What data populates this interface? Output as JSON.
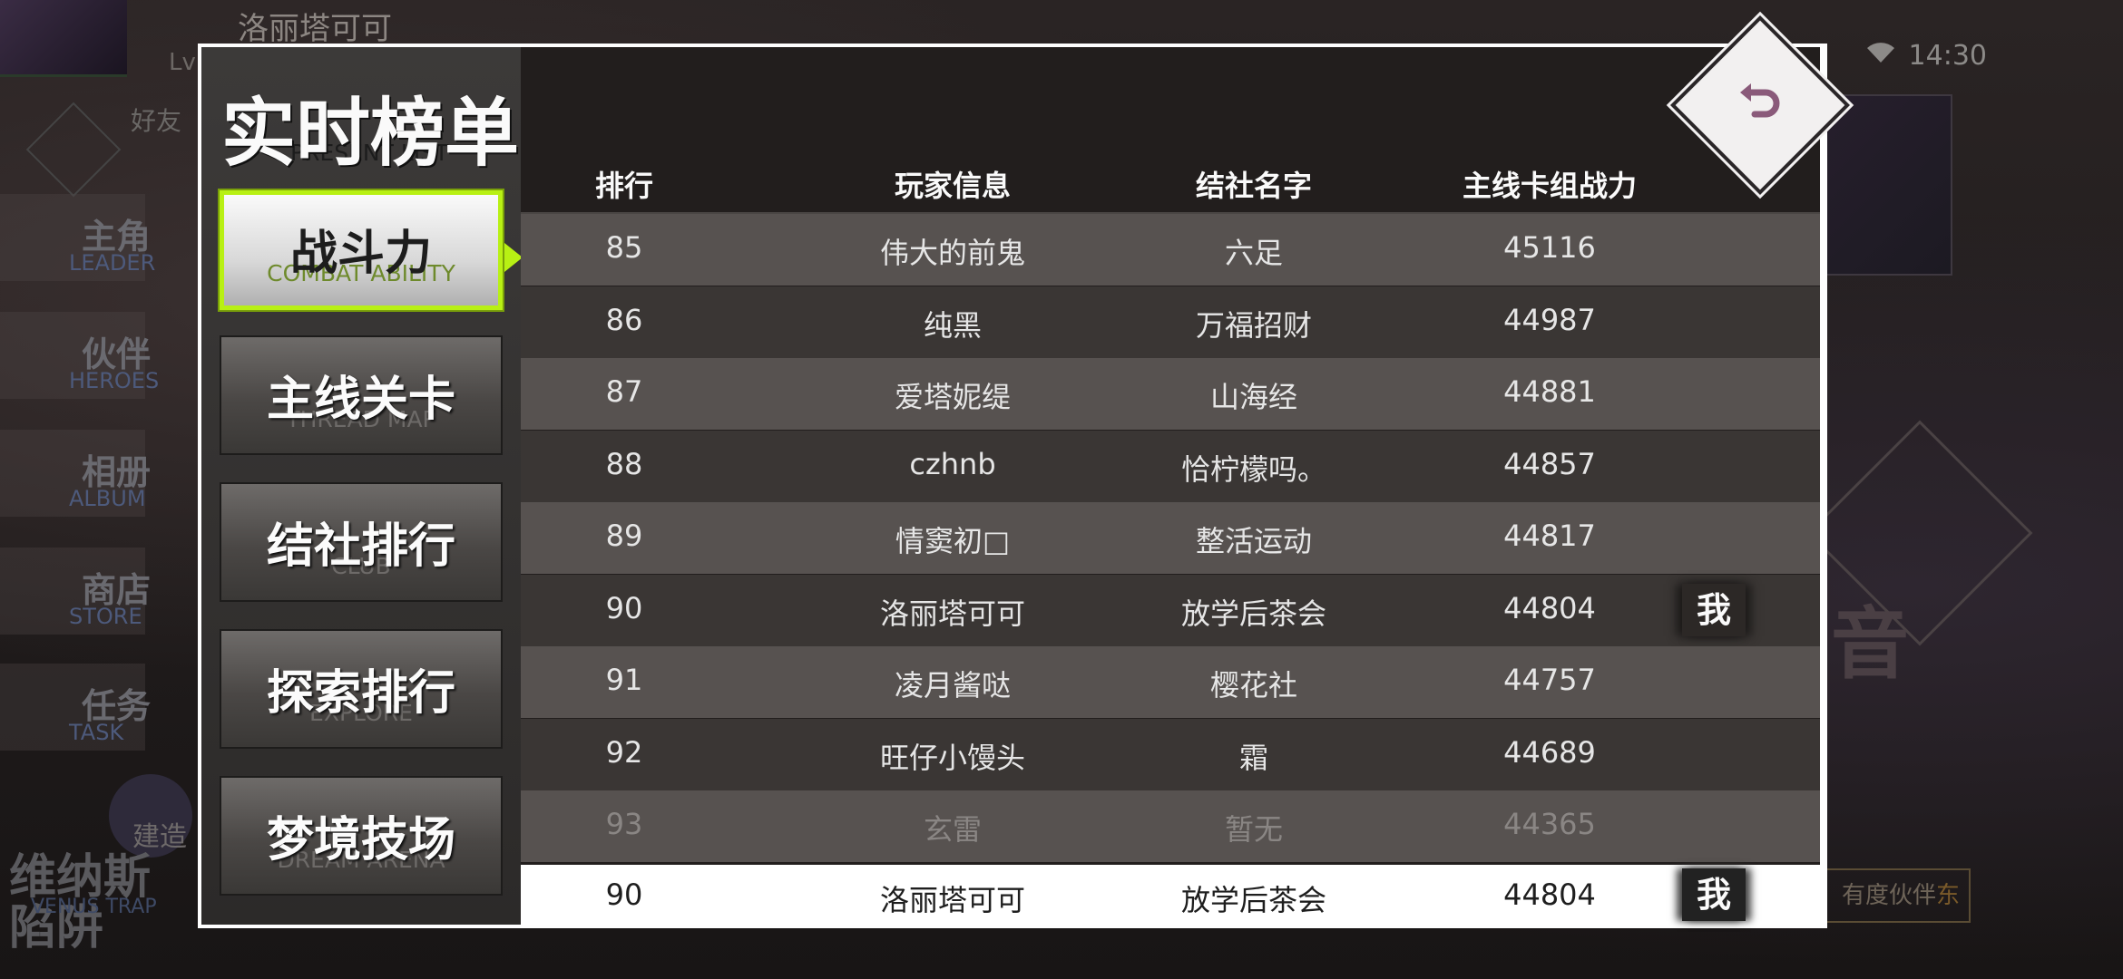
{
  "background": {
    "player_name": "洛丽塔可可",
    "level_label": "Lv",
    "time": "14:30",
    "friend_label": "好友",
    "side_menu": [
      {
        "zh": "主角",
        "en": "LEADER"
      },
      {
        "zh": "伙伴",
        "en": "HEROES"
      },
      {
        "zh": "相册",
        "en": "ALBUM"
      },
      {
        "zh": "商店",
        "en": "STORE"
      },
      {
        "zh": "任务",
        "en": "TASK"
      }
    ],
    "build_label": "建造",
    "venus_zh": "维纳斯陷阱",
    "venus_en": "VENUS TRAP",
    "right_char": "音",
    "right_box_text": "有度伙伴",
    "right_box_accent": "东"
  },
  "dialog": {
    "title_zh": "实时榜单",
    "title_en": "PRESENT LIST",
    "tabs": [
      {
        "zh": "战斗力",
        "en": "COMBAT ABILITY",
        "active": true
      },
      {
        "zh": "主线关卡",
        "en": "THREAD MAP"
      },
      {
        "zh": "结社排行",
        "en": "CLUB"
      },
      {
        "zh": "探索排行",
        "en": "EXPLORE"
      },
      {
        "zh": "梦境技场",
        "en": "DREAM ARENA"
      }
    ],
    "columns": [
      "排行",
      "玩家信息",
      "结社名字",
      "主线卡组战力"
    ],
    "rows": [
      {
        "rank": "85",
        "player": "伟大的前鬼",
        "club": "六足",
        "power": "45116",
        "me": ""
      },
      {
        "rank": "86",
        "player": "纯黑",
        "club": "万福招财",
        "power": "44987",
        "me": ""
      },
      {
        "rank": "87",
        "player": "爱塔妮缇",
        "club": "山海经",
        "power": "44881",
        "me": ""
      },
      {
        "rank": "88",
        "player": "czhnb",
        "club": "恰柠檬吗。",
        "power": "44857",
        "me": ""
      },
      {
        "rank": "89",
        "player": "情窦初□",
        "club": "整活运动",
        "power": "44817",
        "me": ""
      },
      {
        "rank": "90",
        "player": "洛丽塔可可",
        "club": "放学后茶会",
        "power": "44804",
        "me": "我"
      },
      {
        "rank": "91",
        "player": "凌月酱哒",
        "club": "樱花社",
        "power": "44757",
        "me": ""
      },
      {
        "rank": "92",
        "player": "旺仔小馒头",
        "club": "霜",
        "power": "44689",
        "me": ""
      },
      {
        "rank": "93",
        "player": "玄雷",
        "club": "暂无",
        "power": "44365",
        "me": ""
      }
    ],
    "self_row": {
      "rank": "90",
      "player": "洛丽塔可可",
      "club": "放学后茶会",
      "power": "44804",
      "me": "我"
    },
    "back_icon": "return-arrow-icon",
    "accent_color": "#b8f014"
  }
}
